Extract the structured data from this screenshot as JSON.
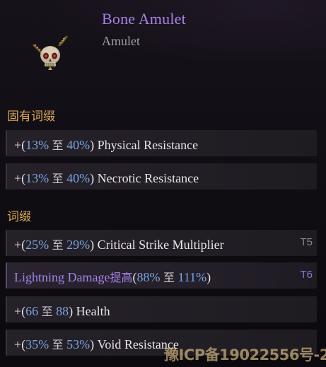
{
  "item": {
    "name": "Bone Amulet",
    "type": "Amulet",
    "icon": "skull-amulet-icon"
  },
  "sections": {
    "implicit_title": "固有词缀",
    "affix_title": "词缀"
  },
  "implicits": [
    {
      "prefix": "+(",
      "min": "13%",
      "to": "至",
      "max": "40%",
      "suffix": ")",
      "stat": "Physical Resistance"
    },
    {
      "prefix": "+(",
      "min": "13%",
      "to": "至",
      "max": "40%",
      "suffix": ")",
      "stat": "Necrotic Resistance"
    }
  ],
  "affixes": [
    {
      "prefix": "+(",
      "min": "25%",
      "to": "至",
      "max": "29%",
      "suffix": ")",
      "stat": "Critical Strike Multiplier",
      "tier": "T5"
    },
    {
      "stat": "Lightning Damage",
      "stat_zh": "提高",
      "prefix": "(",
      "min": "88%",
      "to": "至",
      "max": "111%",
      "suffix": ")",
      "tier": "T6"
    },
    {
      "prefix": "+(",
      "min": "66",
      "to": "至",
      "max": "88",
      "suffix": ")",
      "stat": "Health"
    },
    {
      "prefix": "+(",
      "min": "35%",
      "to": "至",
      "max": "53%",
      "suffix": ")",
      "stat": "Void Resistance"
    }
  ],
  "colors": {
    "title": "#a283e6",
    "section": "#d9a856",
    "range": "#79a4e0",
    "background": "#0f0c11"
  },
  "watermark": "豫ICP备19022556号-2"
}
